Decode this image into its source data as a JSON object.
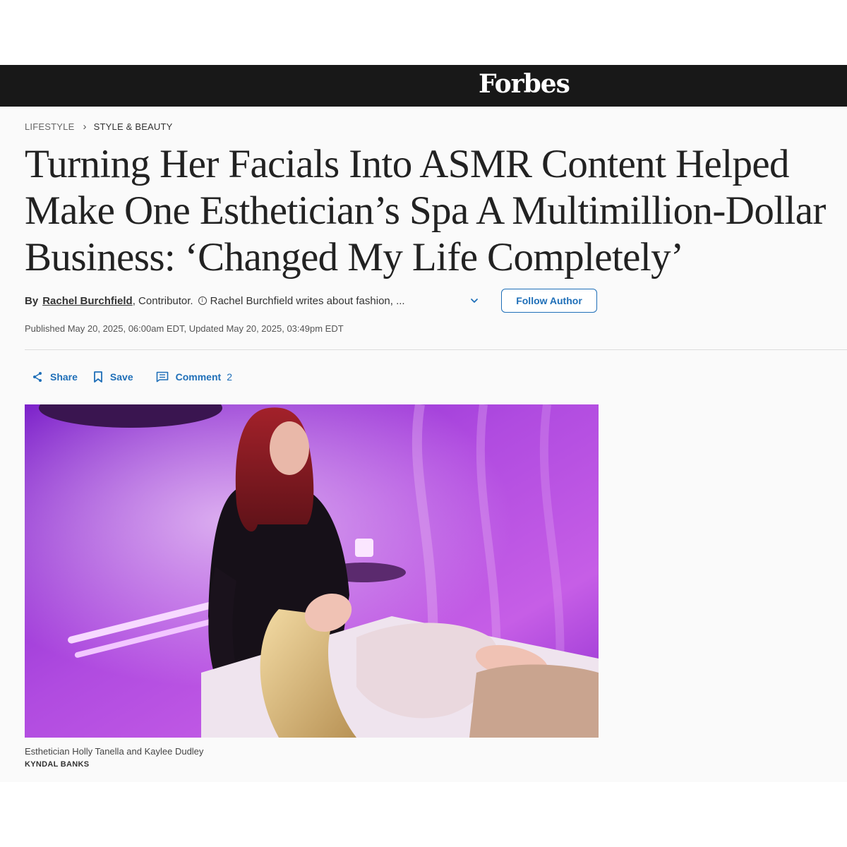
{
  "site": {
    "logo_text": "Forbes"
  },
  "breadcrumb": {
    "section": "LIFESTYLE",
    "subsection": "STYLE & BEAUTY"
  },
  "article": {
    "headline": "Turning Her Facials Into ASMR Content Helped Make One Esthetician’s Spa A Multimillion-Dollar Business: ‘Changed My Life Completely’",
    "byline_prefix": "By",
    "author_name": "Rachel Burchfield",
    "author_role": ", Contributor.",
    "author_bio_snippet": "Rachel Burchfield writes about fashion, ...",
    "follow_label": "Follow Author",
    "dates": "Published May 20, 2025, 06:00am EDT, Updated May 20, 2025, 03:49pm EDT"
  },
  "actions": {
    "share_label": "Share",
    "save_label": "Save",
    "comment_label": "Comment",
    "comment_count": "2"
  },
  "hero": {
    "caption": "Esthetician Holly Tanella and Kaylee Dudley",
    "credit": "KYNDAL BANKS"
  },
  "colors": {
    "topbar": "#181818",
    "accent": "#1f6fb8",
    "photo_purple": "#9b2fd6"
  }
}
